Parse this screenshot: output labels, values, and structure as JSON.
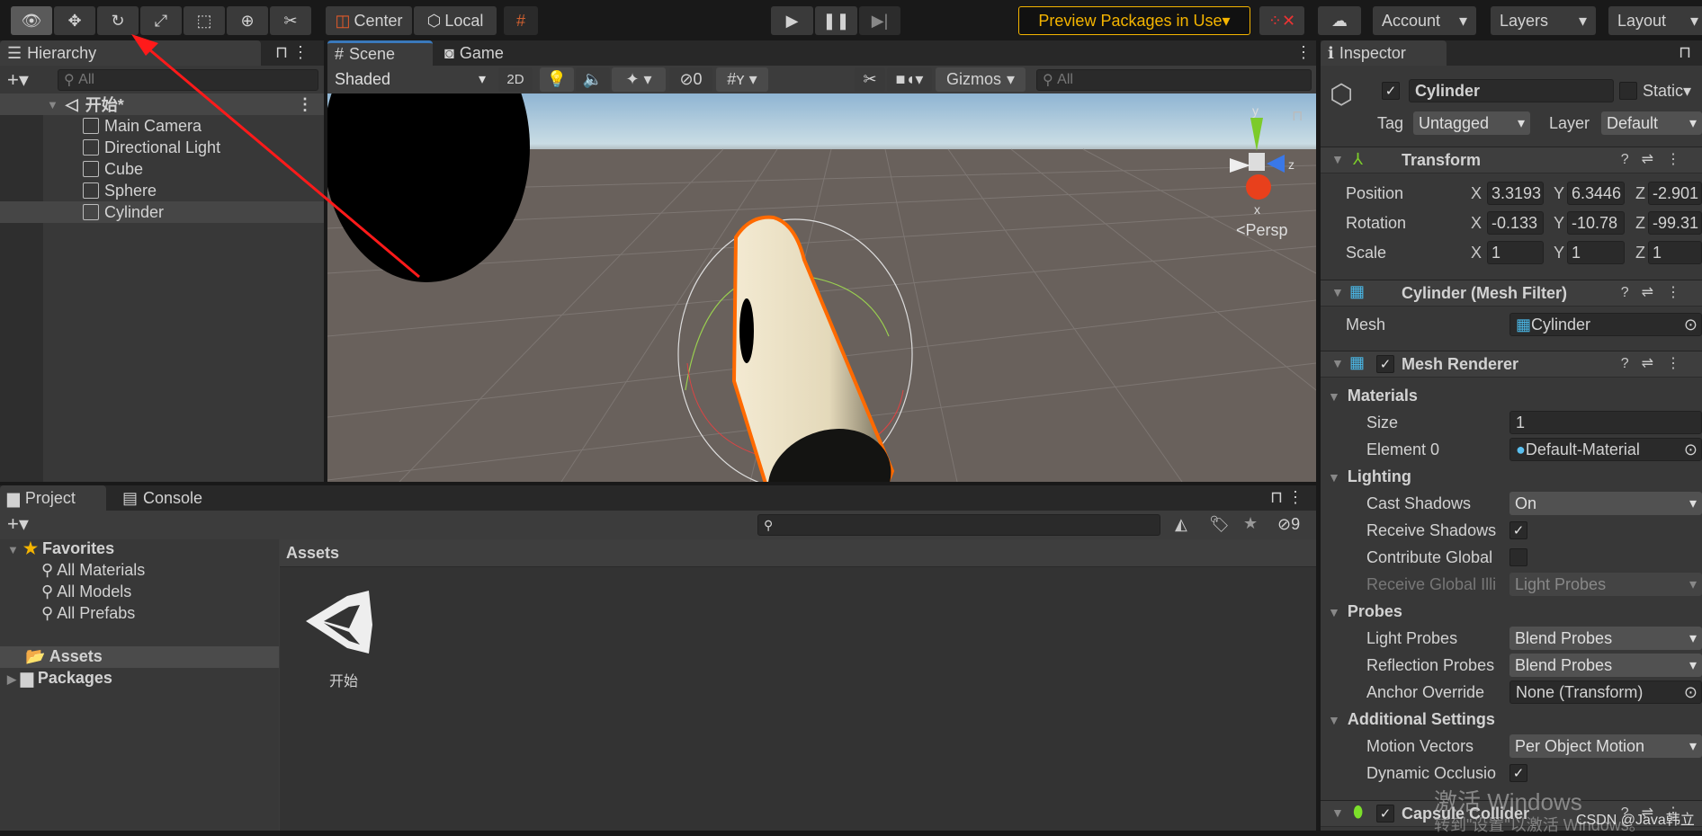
{
  "toolbar": {
    "tools": [
      {
        "icon": "view-tool-icon",
        "active": true
      },
      {
        "icon": "move-tool-icon"
      },
      {
        "icon": "rotate-tool-icon"
      },
      {
        "icon": "scale-tool-icon"
      },
      {
        "icon": "rect-tool-icon"
      },
      {
        "icon": "transform-tool-icon"
      },
      {
        "icon": "custom-tools-icon"
      }
    ],
    "pivot": "Center",
    "space": "Local",
    "preview_packages": "Preview Packages in Use",
    "account": "Account",
    "layers": "Layers",
    "layout": "Layout",
    "preview_color": "#f4b400"
  },
  "hierarchy": {
    "tab": "Hierarchy",
    "search_placeholder": "All",
    "scene": "开始*",
    "items": [
      "Main Camera",
      "Directional Light",
      "Cube",
      "Sphere",
      "Cylinder"
    ],
    "selected": "Cylinder"
  },
  "scene": {
    "tabs": [
      "Scene",
      "Game"
    ],
    "shading": "Shaded",
    "mode_2d": "2D",
    "hidden_count": "0",
    "gizmos": "Gizmos",
    "search_placeholder": "All",
    "projection": "Persp",
    "axis_labels": [
      "y",
      "z",
      "x"
    ]
  },
  "project": {
    "tabs": [
      "Project",
      "Console"
    ],
    "favorites": "Favorites",
    "favorite_items": [
      "All Materials",
      "All Models",
      "All Prefabs"
    ],
    "folders": [
      "Assets",
      "Packages"
    ],
    "breadcrumb": "Assets",
    "assets": [
      {
        "name": "开始",
        "icon": "unity-scene-icon"
      }
    ],
    "hidden_count": "9"
  },
  "inspector": {
    "tab": "Inspector",
    "object_name": "Cylinder",
    "active": true,
    "static_label": "Static",
    "tag_label": "Tag",
    "tag": "Untagged",
    "layer_label": "Layer",
    "layer": "Default",
    "transform": {
      "title": "Transform",
      "rows": [
        {
          "label": "Position",
          "x": "3.3193",
          "y": "6.3446",
          "z": "-2.901"
        },
        {
          "label": "Rotation",
          "x": "-0.133",
          "y": "-10.78",
          "z": "-99.31"
        },
        {
          "label": "Scale",
          "x": "1",
          "y": "1",
          "z": "1"
        }
      ]
    },
    "mesh_filter": {
      "title": "Cylinder (Mesh Filter)",
      "mesh_label": "Mesh",
      "mesh": "Cylinder"
    },
    "mesh_renderer": {
      "title": "Mesh Renderer",
      "enabled": true,
      "materials": "Materials",
      "size_label": "Size",
      "size": "1",
      "element_label": "Element 0",
      "element": "Default-Material",
      "lighting": "Lighting",
      "cast_label": "Cast Shadows",
      "cast": "On",
      "receive_label": "Receive Shadows",
      "receive": true,
      "contribute_label": "Contribute Global",
      "contribute": false,
      "receive_gi_label": "Receive Global Illi",
      "receive_gi": "Light Probes",
      "probes": "Probes",
      "light_probes_label": "Light Probes",
      "light_probes": "Blend Probes",
      "reflection_label": "Reflection Probes",
      "reflection": "Blend Probes",
      "anchor_label": "Anchor Override",
      "anchor": "None (Transform)",
      "additional": "Additional Settings",
      "motion_label": "Motion Vectors",
      "motion": "Per Object Motion",
      "occlusion_label": "Dynamic Occlusio",
      "occlusion": true
    },
    "capsule": {
      "title": "Capsule Collider",
      "enabled": true
    }
  },
  "watermark": {
    "line1": "激活 Windows",
    "line2": "转到\"设置\"以激活 Windows。",
    "csdn": "CSDN @Java韩立"
  }
}
